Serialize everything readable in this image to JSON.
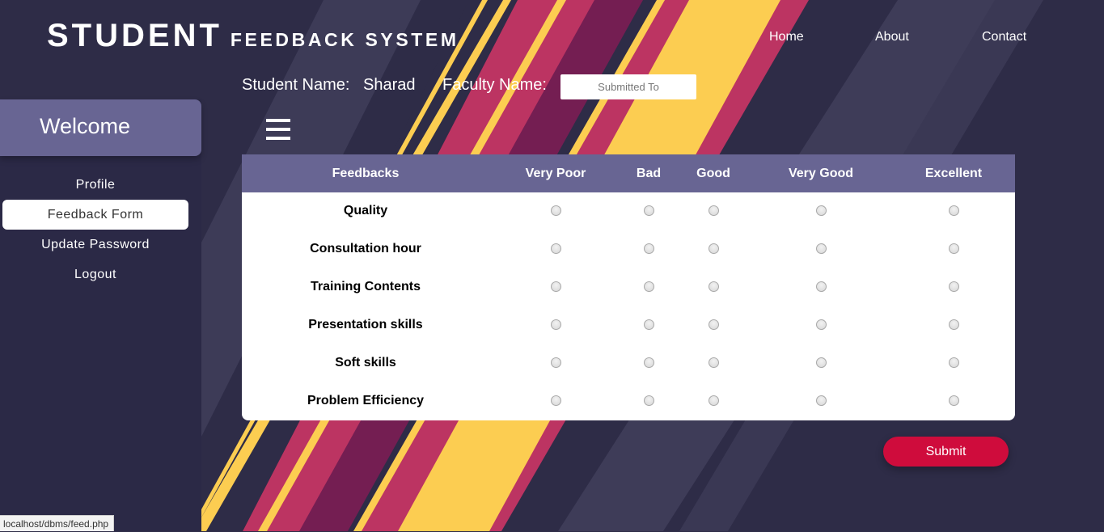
{
  "brand": {
    "main": "STUDENT",
    "sub": "FEEDBACK SYSTEM"
  },
  "nav": [
    {
      "label": "Home"
    },
    {
      "label": "About"
    },
    {
      "label": "Contact"
    }
  ],
  "info": {
    "student_label": "Student Name:",
    "student_value": "Sharad",
    "faculty_label": "Faculty Name:",
    "faculty_placeholder": "Submitted To",
    "faculty_value": ""
  },
  "sidebar": {
    "welcome": "Welcome",
    "items": [
      {
        "label": "Profile",
        "active": false
      },
      {
        "label": "Feedback Form",
        "active": true
      },
      {
        "label": "Update Password",
        "active": false
      },
      {
        "label": "Logout",
        "active": false
      }
    ]
  },
  "table": {
    "headers": [
      "Feedbacks",
      "Very Poor",
      "Bad",
      "Good",
      "Very Good",
      "Excellent"
    ],
    "rows": [
      {
        "label": "Quality",
        "selected": null
      },
      {
        "label": "Consultation hour",
        "selected": null
      },
      {
        "label": "Training Contents",
        "selected": null
      },
      {
        "label": "Presentation skills",
        "selected": null
      },
      {
        "label": "Soft skills",
        "selected": null
      },
      {
        "label": "Problem Efficiency",
        "selected": null
      }
    ]
  },
  "submit_label": "Submit",
  "status_url": "localhost/dbms/feed.php",
  "colors": {
    "background": "#2e2c47",
    "header_purple": "#686593",
    "stripe_pink": "#bc3462",
    "stripe_maroon": "#741e52",
    "stripe_yellow": "#fccd51",
    "stripe_grey": "#3e3c58",
    "submit_red": "#cf0c3c"
  }
}
